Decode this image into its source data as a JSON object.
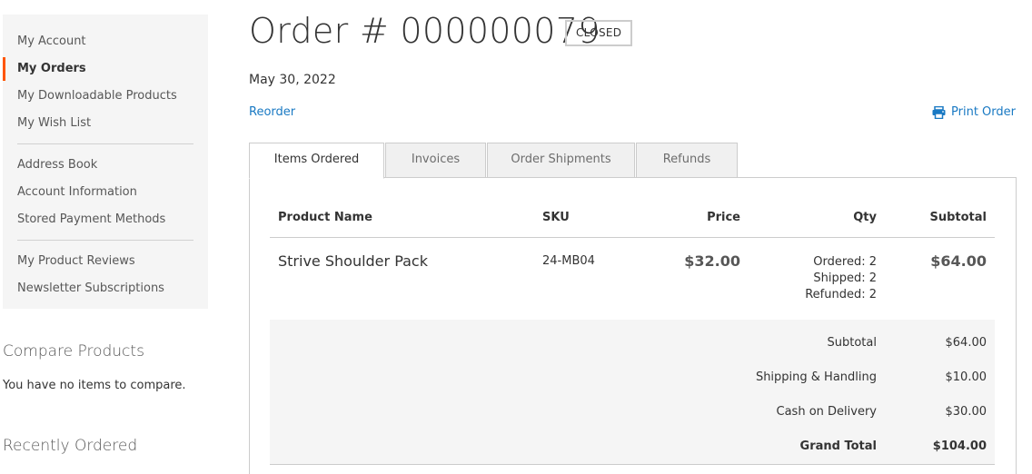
{
  "sidebar": {
    "groups": [
      [
        {
          "label": "My Account",
          "current": false
        },
        {
          "label": "My Orders",
          "current": true
        },
        {
          "label": "My Downloadable Products",
          "current": false
        },
        {
          "label": "My Wish List",
          "current": false
        }
      ],
      [
        {
          "label": "Address Book",
          "current": false
        },
        {
          "label": "Account Information",
          "current": false
        },
        {
          "label": "Stored Payment Methods",
          "current": false
        }
      ],
      [
        {
          "label": "My Product Reviews",
          "current": false
        },
        {
          "label": "Newsletter Subscriptions",
          "current": false
        }
      ]
    ]
  },
  "compare": {
    "title": "Compare Products",
    "empty_text": "You have no items to compare."
  },
  "recent": {
    "title": "Recently Ordered"
  },
  "order": {
    "title": "Order # 000000079",
    "status": "Closed",
    "date": "May 30, 2022",
    "reorder_label": "Reorder",
    "print_label": "Print Order"
  },
  "tabs": [
    {
      "label": "Items Ordered",
      "active": true
    },
    {
      "label": "Invoices",
      "active": false
    },
    {
      "label": "Order Shipments",
      "active": false
    },
    {
      "label": "Refunds",
      "active": false
    }
  ],
  "table": {
    "headers": {
      "product": "Product Name",
      "sku": "SKU",
      "price": "Price",
      "qty": "Qty",
      "subtotal": "Subtotal"
    },
    "rows": [
      {
        "product": "Strive Shoulder Pack",
        "sku": "24-MB04",
        "price": "$32.00",
        "qty": [
          "Ordered: 2",
          "Shipped: 2",
          "Refunded: 2"
        ],
        "subtotal": "$64.00"
      }
    ],
    "totals": [
      {
        "label": "Subtotal",
        "amount": "$64.00",
        "grand": false
      },
      {
        "label": "Shipping & Handling",
        "amount": "$10.00",
        "grand": false
      },
      {
        "label": "Cash on Delivery",
        "amount": "$30.00",
        "grand": false
      },
      {
        "label": "Grand Total",
        "amount": "$104.00",
        "grand": true
      }
    ]
  },
  "colors": {
    "accent": "#ff5501",
    "link": "#1979c3"
  },
  "icons": {
    "print": "printer-icon"
  }
}
